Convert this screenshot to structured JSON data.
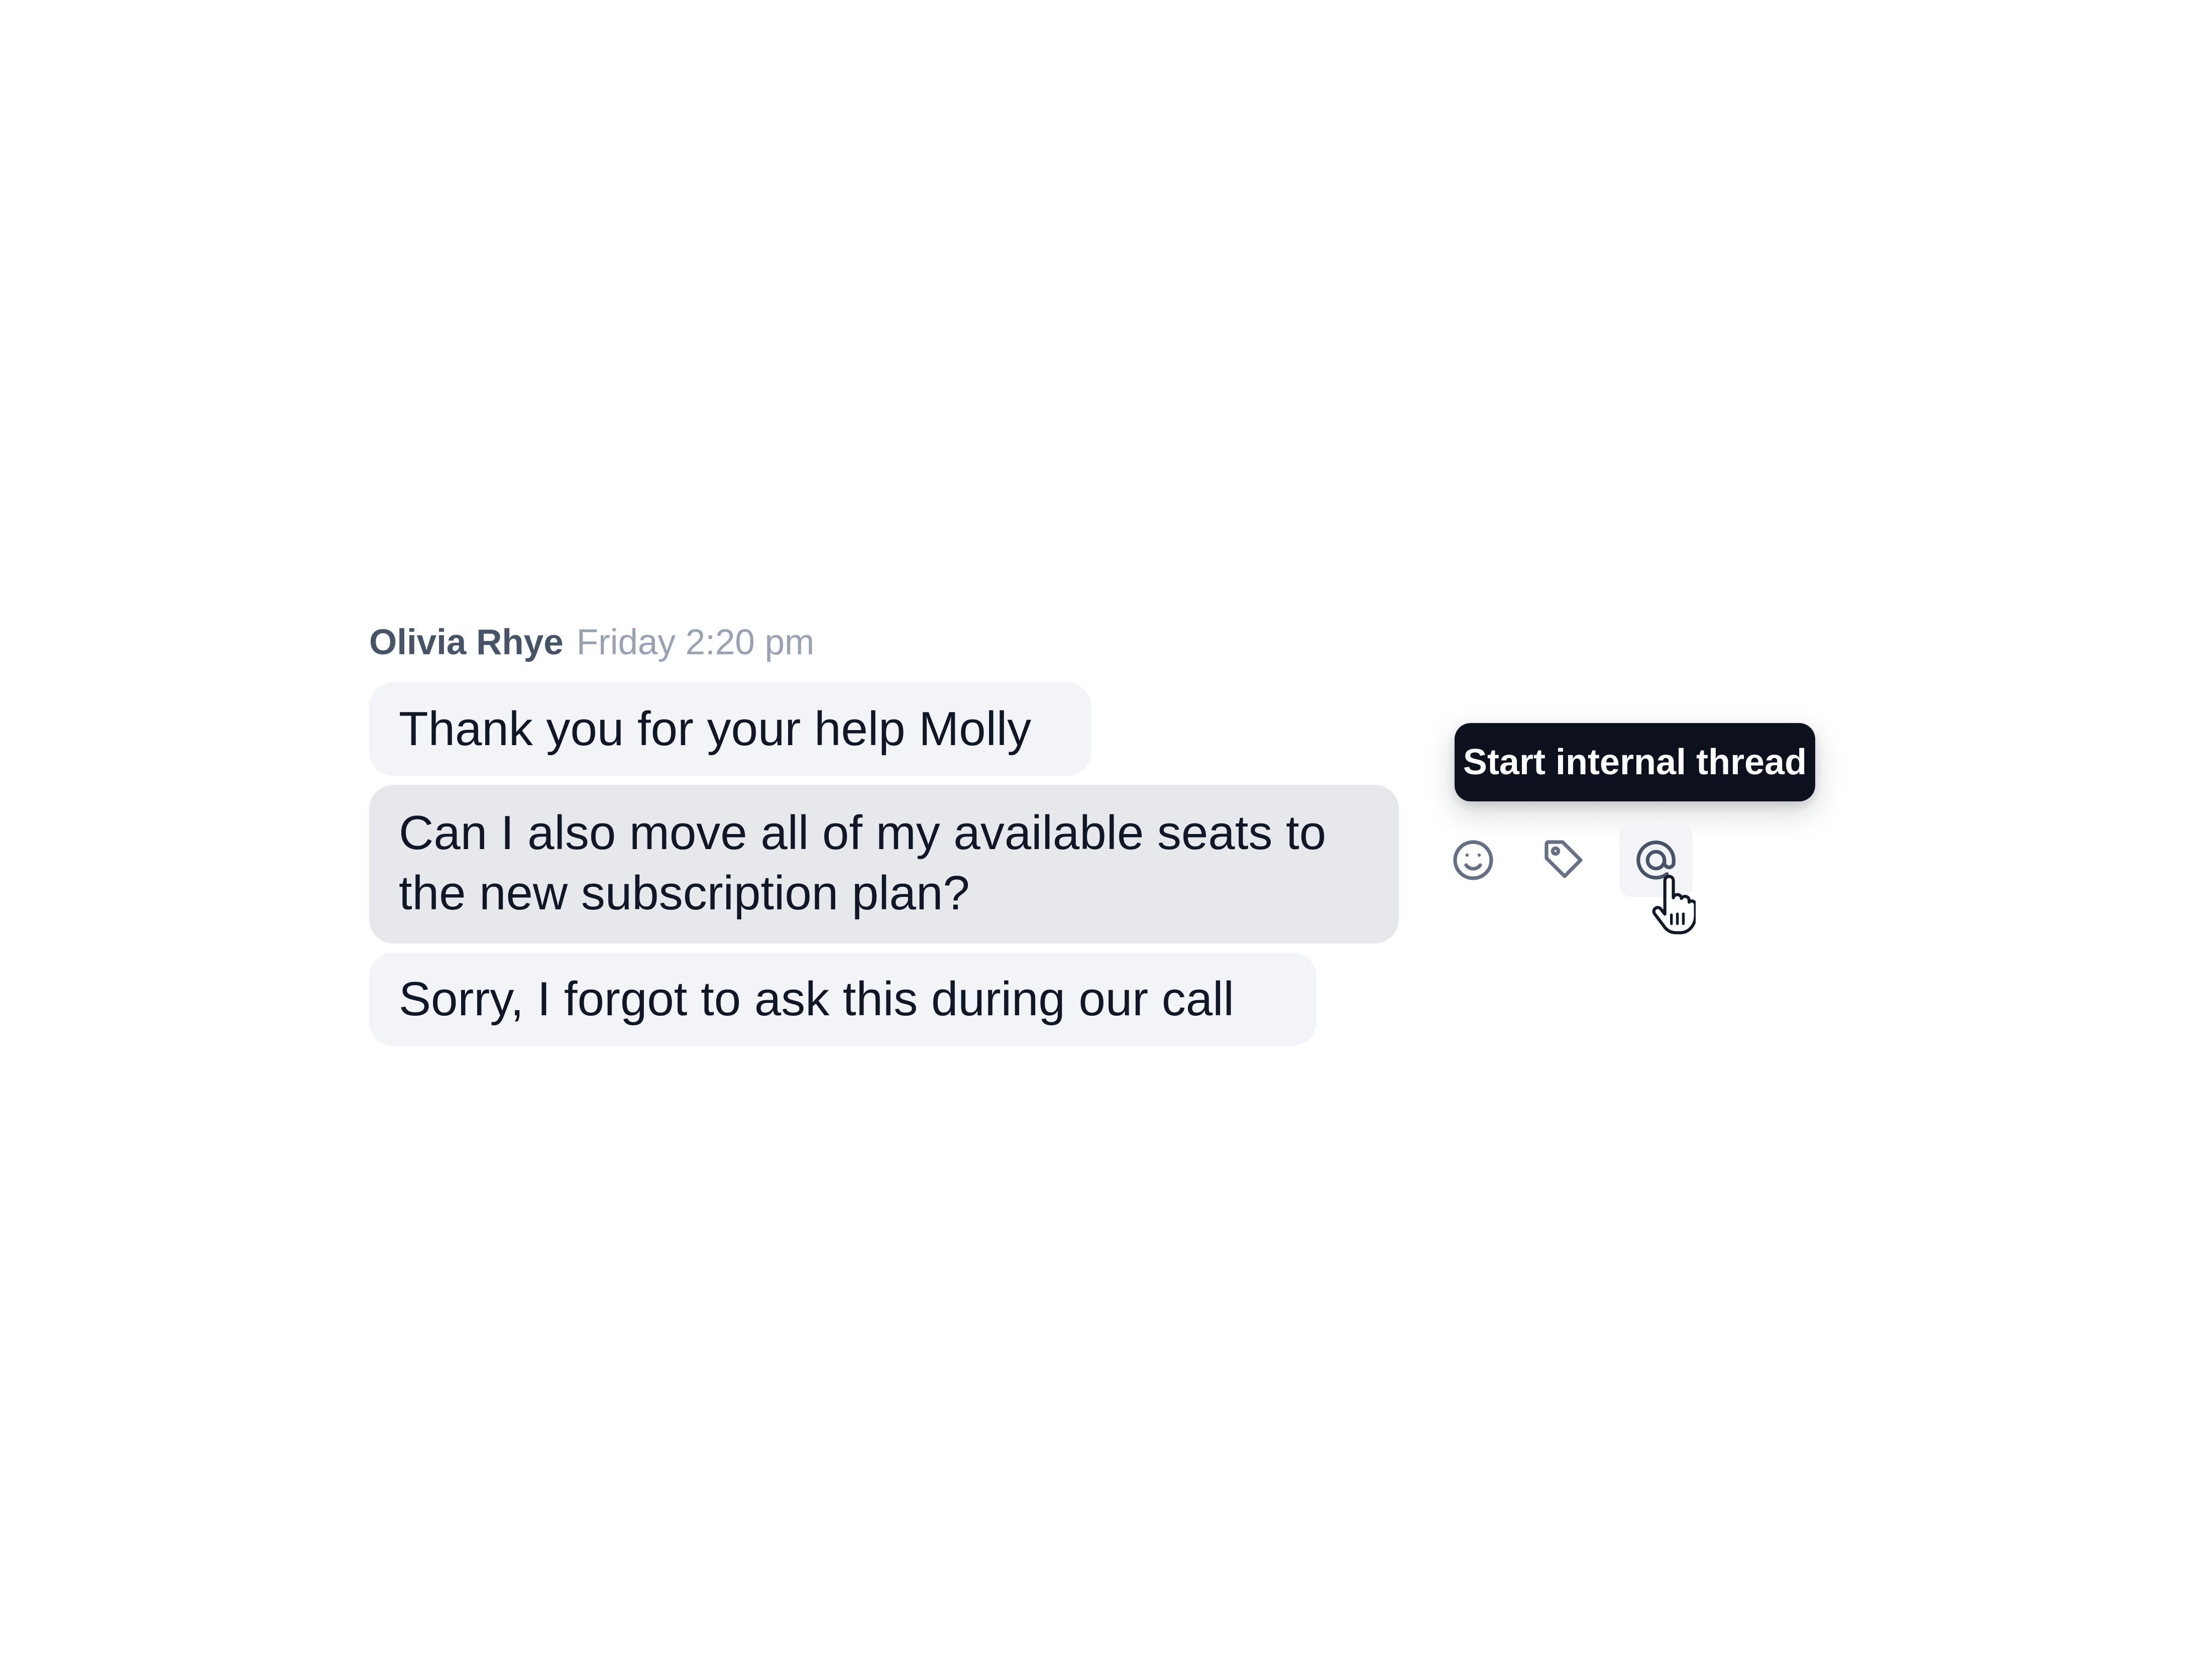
{
  "message": {
    "author": "Olivia Rhye",
    "timestamp": "Friday 2:20 pm",
    "bubbles": [
      "Thank you for your help Molly",
      "Can I also move all of my available seats to the new subscription plan?",
      "Sorry, I forgot to ask this during our call"
    ]
  },
  "actions": {
    "tooltip": "Start internal thread",
    "icons": [
      "smile-icon",
      "tag-icon",
      "at-icon"
    ]
  },
  "colors": {
    "bubble": "#f2f4f7",
    "bubble_active": "#e6e8ec",
    "tooltip": "#0c111d"
  }
}
